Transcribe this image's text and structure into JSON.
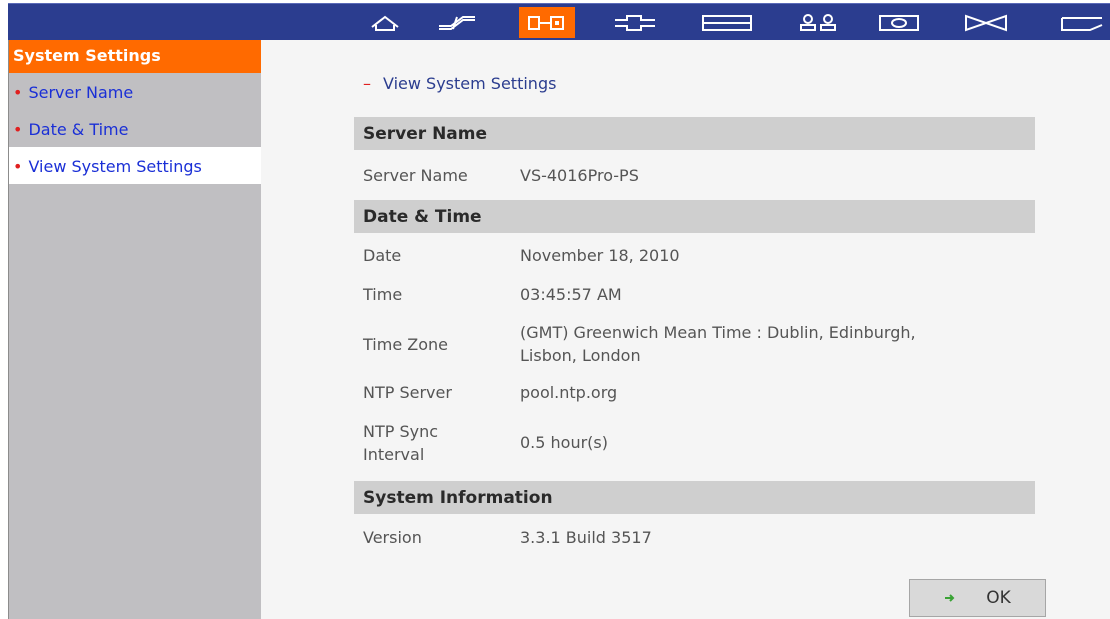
{
  "colors": {
    "nav_bar": "#2b3d8f",
    "accent_orange": "#ff6a00",
    "sidebar_bg": "#c0bfc2",
    "link_blue": "#1a2fd6",
    "bullet_red": "#e02020"
  },
  "topnav": {
    "icons": [
      "home-icon",
      "quick-config-icon",
      "system-admin-icon",
      "disk-management-icon",
      "access-right-icon",
      "user-management-icon",
      "network-services-icon",
      "application-icon",
      "backup-icon"
    ],
    "active": "system-admin-icon"
  },
  "sidebar": {
    "header": "System Settings",
    "items": [
      {
        "label": "Server Name",
        "selected": false
      },
      {
        "label": "Date & Time",
        "selected": false
      },
      {
        "label": "View System Settings",
        "selected": true
      }
    ]
  },
  "main": {
    "view_title_prefix": "–",
    "view_title": "View System Settings",
    "sections": {
      "server_name": {
        "title": "Server Name",
        "rows": [
          {
            "label": "Server Name",
            "value": "VS-4016Pro-PS"
          }
        ]
      },
      "date_time": {
        "title": "Date & Time",
        "rows": [
          {
            "label": "Date",
            "value": "November 18, 2010"
          },
          {
            "label": "Time",
            "value": "03:45:57 AM"
          },
          {
            "label": "Time Zone",
            "value_line1": "(GMT) Greenwich Mean Time : Dublin, Edinburgh,",
            "value_line2": "Lisbon, London"
          },
          {
            "label": "NTP Server",
            "value": "pool.ntp.org"
          },
          {
            "label_line1": "NTP Sync",
            "label_line2": "Interval",
            "value": "0.5 hour(s)"
          }
        ]
      },
      "system_information": {
        "title": "System Information",
        "rows": [
          {
            "label": "Version",
            "value": "3.3.1 Build 3517"
          }
        ]
      }
    },
    "ok_button": {
      "icon": "arrow-right-icon",
      "label": "OK"
    }
  }
}
